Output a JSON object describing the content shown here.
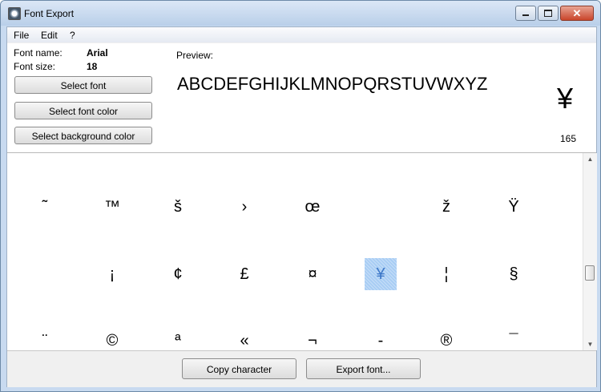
{
  "window": {
    "title": "Font Export"
  },
  "menu": [
    "File",
    "Edit",
    "?"
  ],
  "font_info": {
    "name_label": "Font name:",
    "name_value": "Arial",
    "size_label": "Font size:",
    "size_value": "18"
  },
  "buttons": {
    "select_font": "Select font",
    "select_font_color": "Select font color",
    "select_background_color": "Select background color",
    "copy_character": "Copy character",
    "export_font": "Export font..."
  },
  "preview": {
    "label": "Preview:",
    "text": "ABCDEFGHIJKLMNOPQRSTUVWXYZ",
    "selected_char": "¥",
    "selected_code": "165"
  },
  "grid": {
    "rows": [
      [
        "˜",
        "™",
        "š",
        "›",
        "œ",
        "",
        "ž",
        "Ÿ"
      ],
      [
        "",
        "¡",
        "¢",
        "£",
        "¤",
        "¥",
        "¦",
        "§"
      ],
      [
        "¨",
        "©",
        "ª",
        "«",
        "¬",
        "-",
        "®",
        "¯"
      ]
    ],
    "selected": "¥"
  },
  "colors": {
    "selection": "#a8cdf4",
    "titlebar": "#c8daf0"
  }
}
